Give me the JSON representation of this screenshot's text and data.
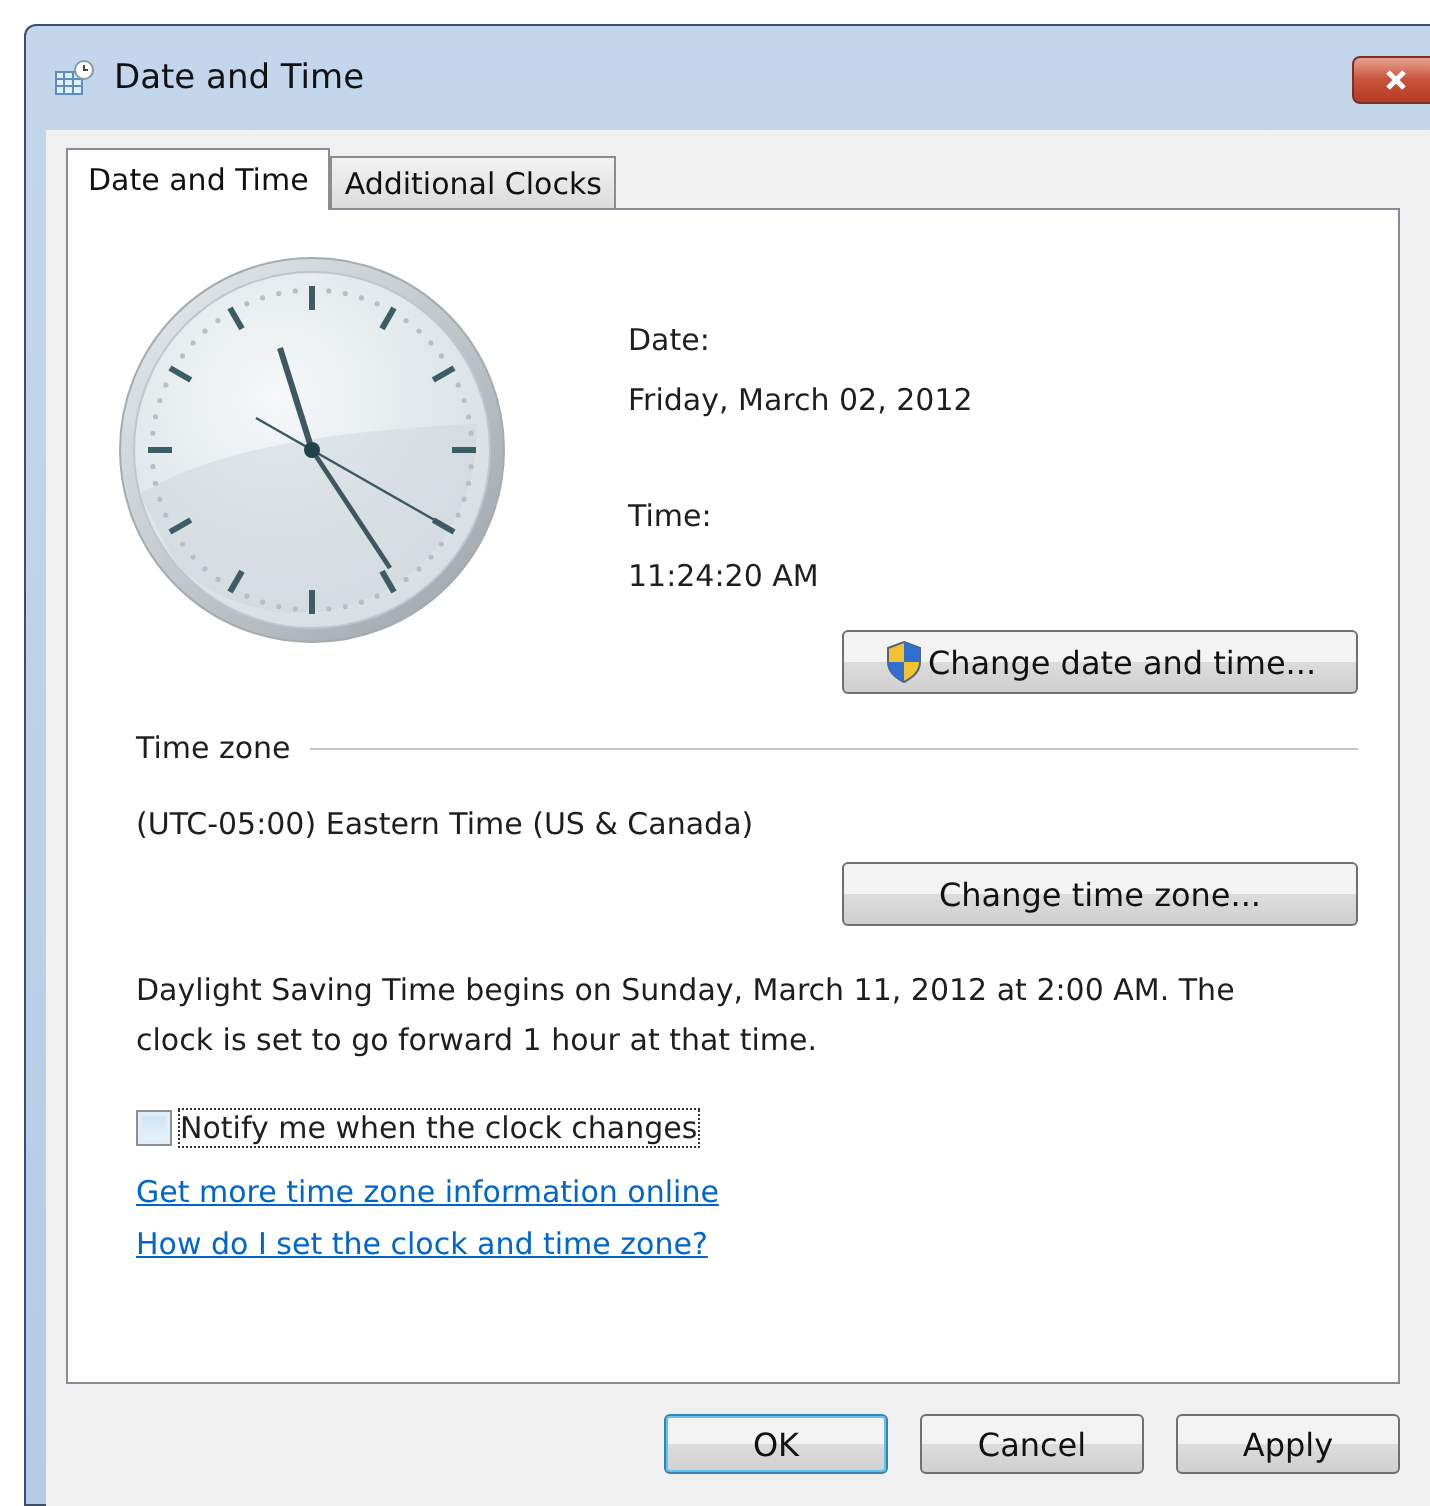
{
  "window": {
    "title": "Date and Time"
  },
  "tabs": [
    {
      "label": "Date and Time",
      "selected": true
    },
    {
      "label": "Additional Clocks",
      "selected": false
    }
  ],
  "date": {
    "label": "Date:",
    "value": "Friday, March 02, 2012"
  },
  "time": {
    "label": "Time:",
    "value": "11:24:20 AM"
  },
  "change_date_button": {
    "label": "Change date and time..."
  },
  "time_zone": {
    "heading": "Time zone",
    "value": "(UTC-05:00) Eastern Time (US & Canada)",
    "button": "Change time zone..."
  },
  "dst_note": "Daylight Saving Time begins on Sunday, March 11, 2012 at 2:00 AM. The clock is set to go forward 1 hour at that time.",
  "notify": {
    "label": "Notify me when the clock changes",
    "checked": false
  },
  "links": [
    "Get more time zone information online",
    "How do I set the clock and time zone?"
  ],
  "buttons": [
    {
      "label": "OK",
      "default": true
    },
    {
      "label": "Cancel",
      "default": false
    },
    {
      "label": "Apply",
      "default": false
    }
  ]
}
